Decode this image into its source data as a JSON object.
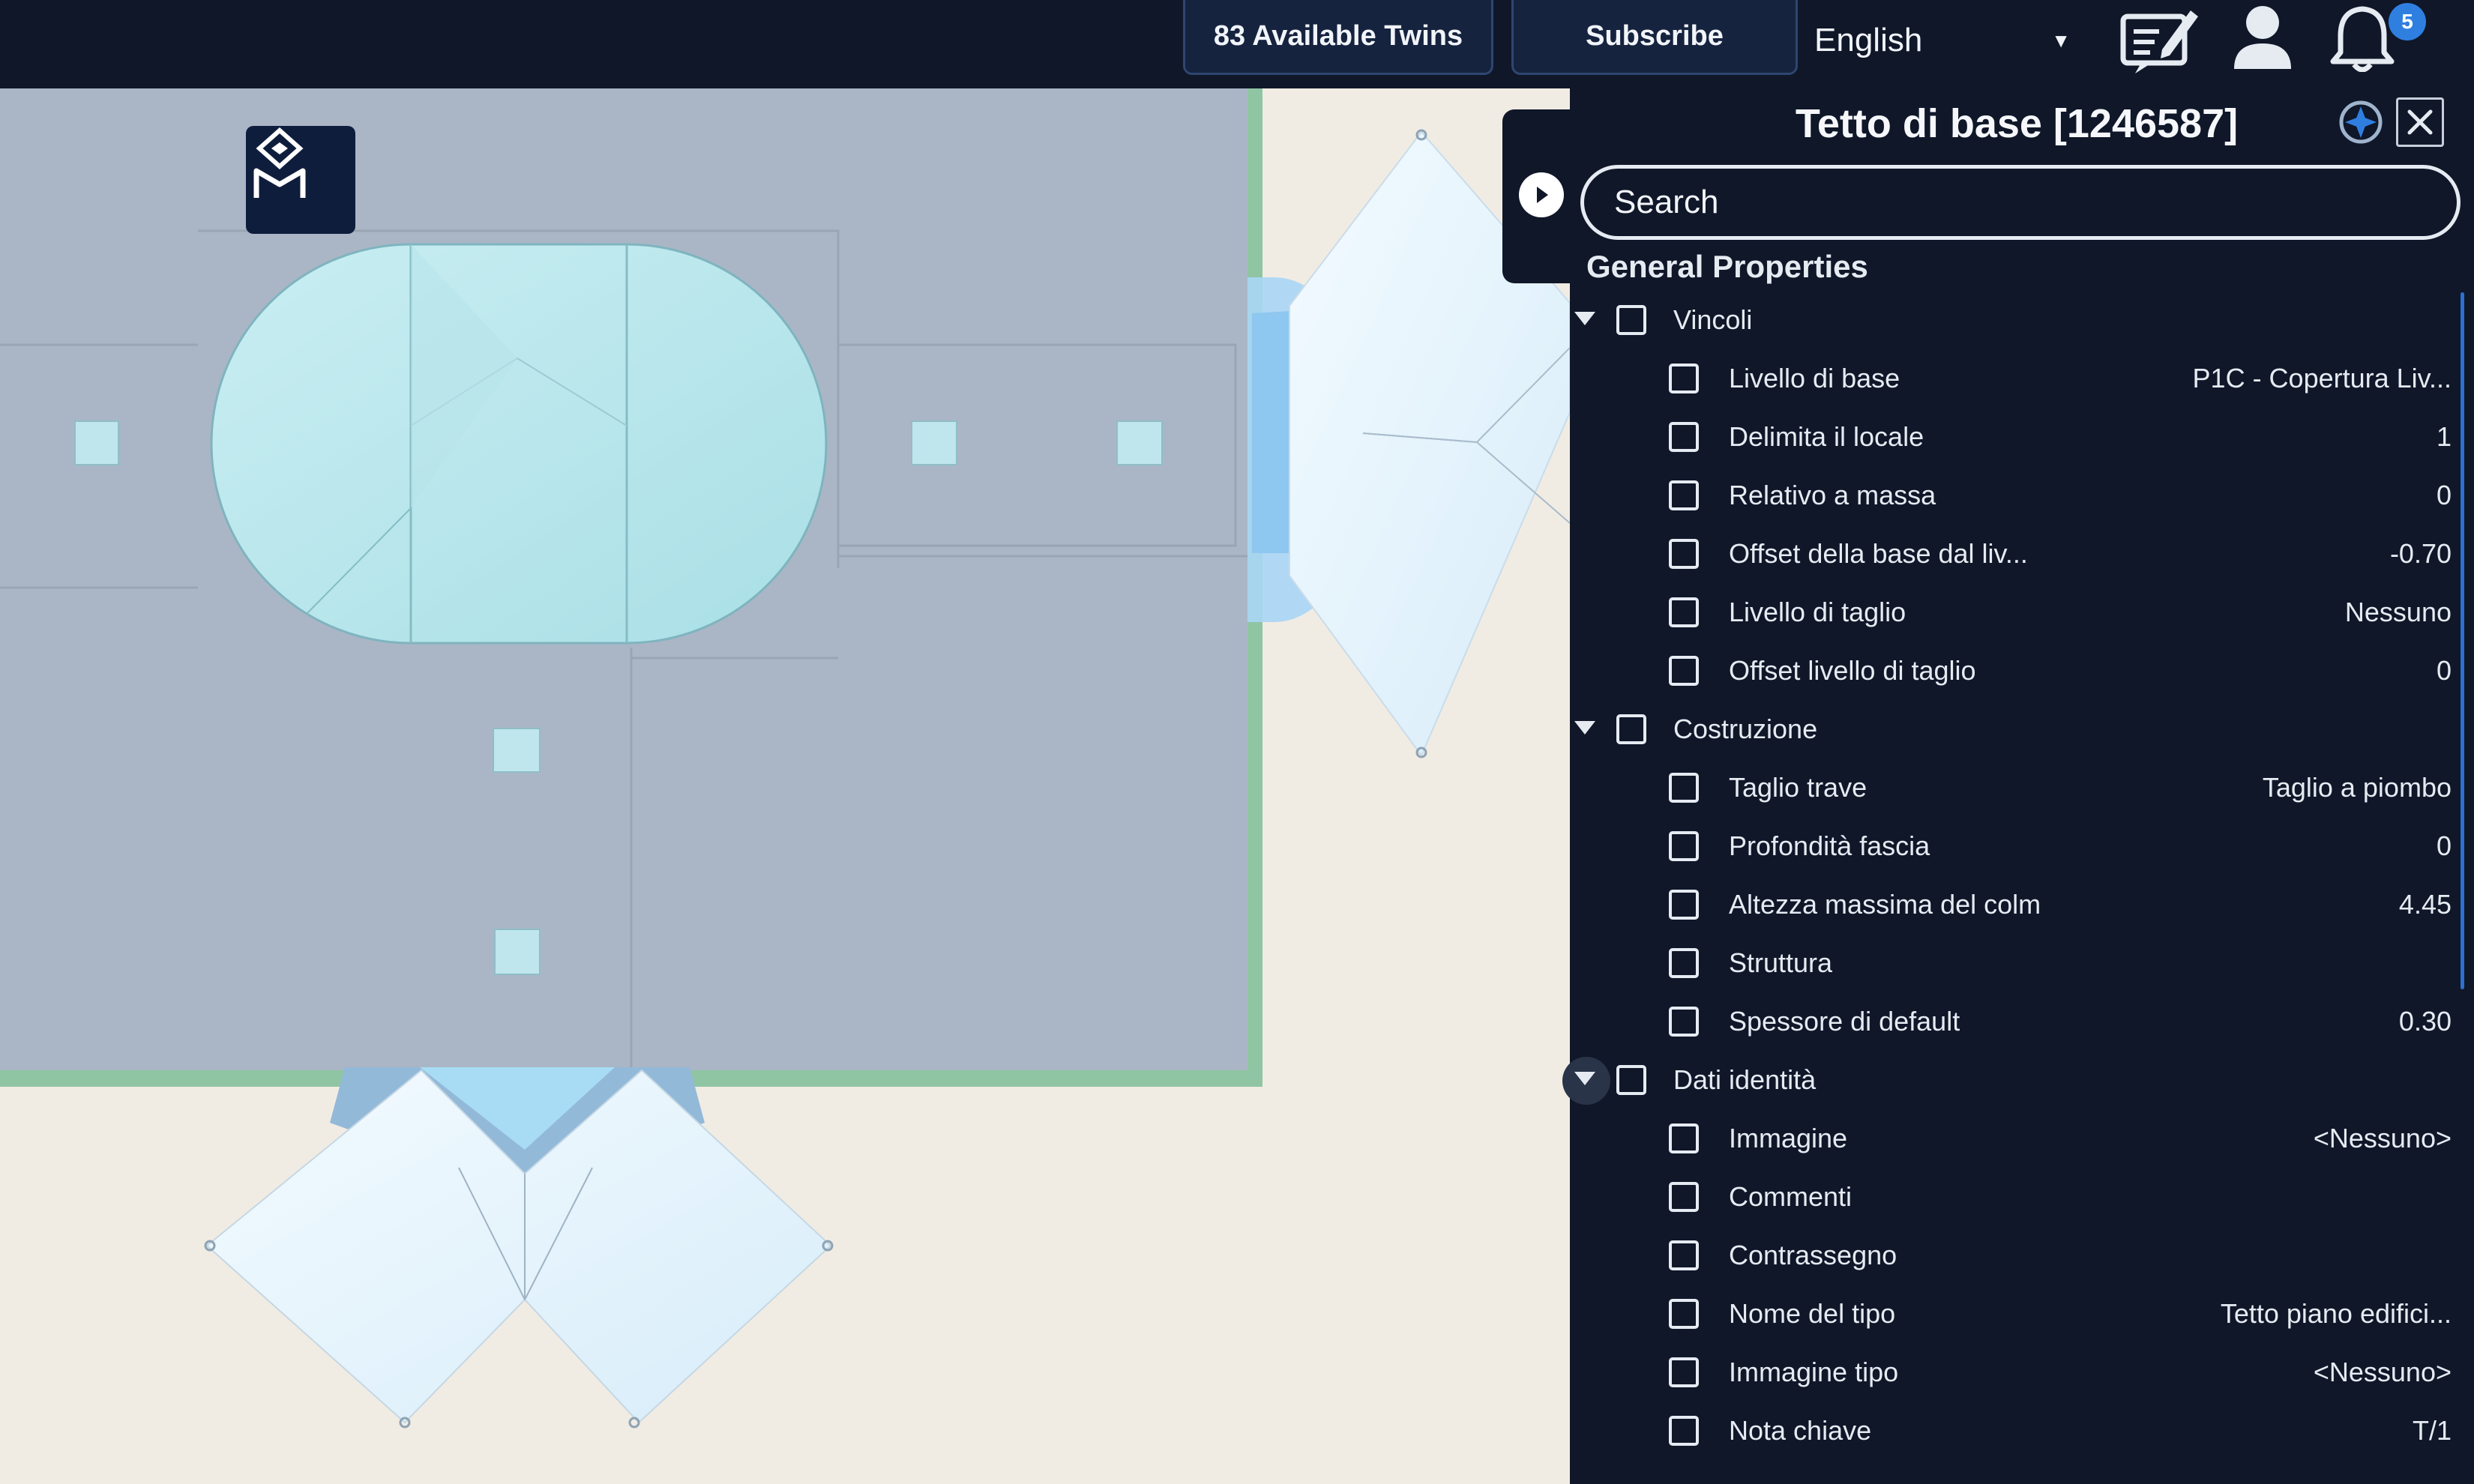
{
  "topbar": {
    "twins_label": "83 Available Twins",
    "subscribe_label": "Subscribe",
    "language": "English",
    "notification_count": "5"
  },
  "icons": {
    "notes": "notes-edit-icon",
    "user": "user-icon",
    "bell": "bell-icon",
    "logo": "app-logo-icon",
    "collapse": "chevron-right-icon",
    "target": "target-icon",
    "close": "close-icon"
  },
  "colors": {
    "panel_bg": "#0f1729",
    "accent": "#2f7fe0",
    "floor": "#aab6c6",
    "glass": "#bfe8ee",
    "ground": "#f1ece3"
  },
  "panel": {
    "title": "Tetto di base [1246587]",
    "search_placeholder": "Search",
    "section": "General Properties",
    "groups": [
      {
        "label": "Vincoli",
        "props": [
          {
            "label": "Livello di base",
            "value": "P1C - Copertura Liv..."
          },
          {
            "label": "Delimita il locale",
            "value": "1"
          },
          {
            "label": "Relativo a massa",
            "value": "0"
          },
          {
            "label": "Offset della base dal liv...",
            "value": "-0.70"
          },
          {
            "label": "Livello di taglio",
            "value": "Nessuno"
          },
          {
            "label": "Offset livello di taglio",
            "value": "0"
          }
        ]
      },
      {
        "label": "Costruzione",
        "props": [
          {
            "label": "Taglio trave",
            "value": "Taglio a piombo"
          },
          {
            "label": "Profondità fascia",
            "value": "0"
          },
          {
            "label": "Altezza massima del colm",
            "value": "4.45"
          },
          {
            "label": "Struttura",
            "value": ""
          },
          {
            "label": "Spessore di default",
            "value": "0.30"
          }
        ]
      },
      {
        "label": "Dati identità",
        "props": [
          {
            "label": "Immagine",
            "value": "<Nessuno>"
          },
          {
            "label": "Commenti",
            "value": ""
          },
          {
            "label": "Contrassegno",
            "value": ""
          },
          {
            "label": "Nome del tipo",
            "value": "Tetto piano edifici..."
          },
          {
            "label": "Immagine tipo",
            "value": "<Nessuno>"
          },
          {
            "label": "Nota chiave",
            "value": "T/1"
          }
        ]
      }
    ]
  }
}
